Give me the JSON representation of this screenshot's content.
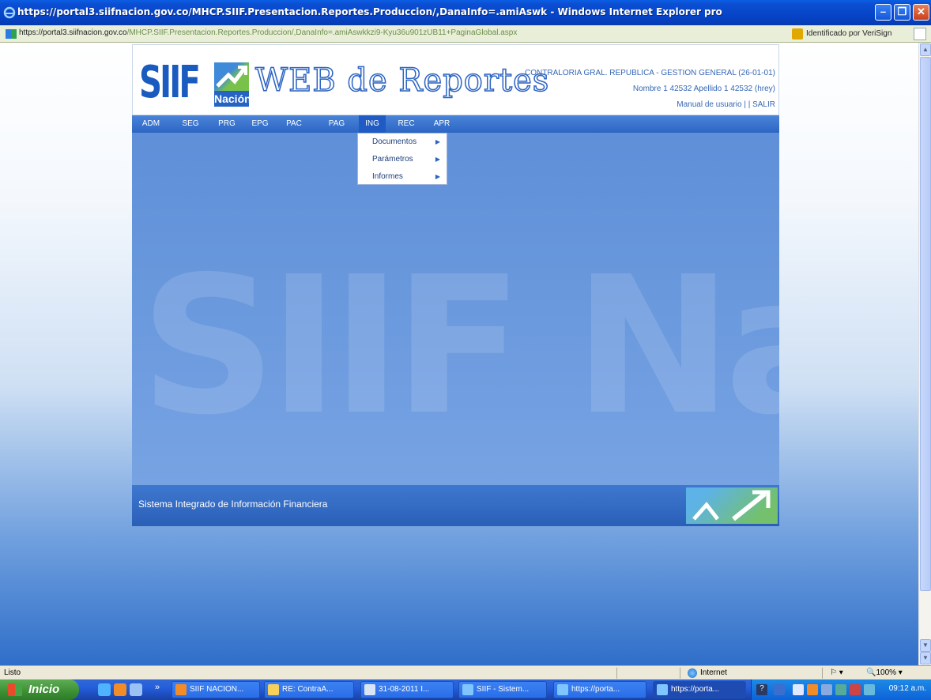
{
  "window": {
    "title": "https://portal3.siifnacion.gov.co/MHCP.SIIF.Presentacion.Reportes.Produccion/,DanaInfo=.amiAswk - Windows Internet Explorer pro",
    "controls": [
      "minimize",
      "restore",
      "close"
    ]
  },
  "address": {
    "url_prefix": "https://portal3.",
    "url_host": "siifnacion.gov.co",
    "url_rest": "/MHCP.SIIF.Presentacion.Reportes.Produccion/,DanaInfo=.amiAswkkzi9-Kyu36u901zUB11+PaginaGlobal.aspx",
    "security_label": "Identificado por VeriSign"
  },
  "portal": {
    "logo_text": "SIIF",
    "logo_sub": "Nación",
    "app_title": "WEB de Reportes",
    "entity": "CONTRALORIA GRAL. REPUBLICA - GESTION GENERAL (26-01-01)",
    "user": "Nombre 1 42532 Apellido 1 42532 (hrey)",
    "manual_link": "Manual de usuario",
    "separator": "| |",
    "exit_link": "SALIR",
    "menu": [
      "ADM",
      "SEG",
      "PRG",
      "EPG",
      "PAC",
      "PAG",
      "ING",
      "REC",
      "APR"
    ],
    "active_menu": "ING",
    "submenu": [
      "Documentos",
      "Parámetros",
      "Informes"
    ],
    "footer_text": "Sistema Integrado de Información Financiera",
    "watermark": "SIIF Nacion"
  },
  "statusbar": {
    "status": "Listo",
    "zone": "Internet",
    "zoom": "100%"
  },
  "taskbar": {
    "start_label": "Inicio",
    "tasks": [
      "SIIF NACION...",
      "RE: ContraA...",
      "31-08-2011 I...",
      "SIIF - Sistem...",
      "https://porta...",
      "https://porta..."
    ],
    "clock": "09:12 a.m."
  }
}
